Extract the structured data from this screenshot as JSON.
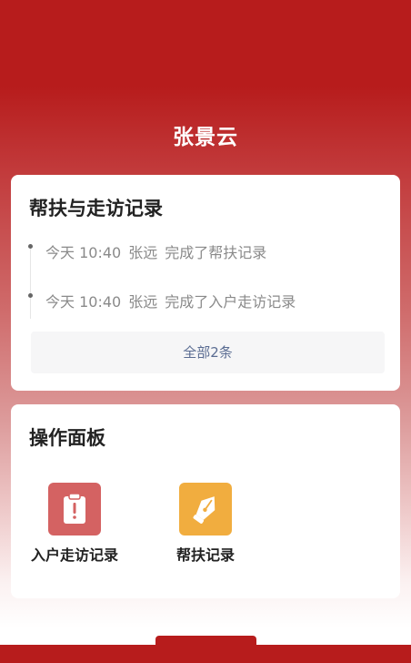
{
  "header": {
    "title": "张景云"
  },
  "records": {
    "title": "帮扶与走访记录",
    "items": [
      {
        "time": "今天 10:40",
        "person": "张远",
        "action": "完成了帮扶记录"
      },
      {
        "time": "今天 10:40",
        "person": "张远",
        "action": "完成了入户走访记录"
      }
    ],
    "all_label": "全部2条"
  },
  "panel": {
    "title": "操作面板",
    "items": [
      {
        "label": "入户走访记录",
        "icon": "clipboard-alert-icon",
        "color": "#d46262"
      },
      {
        "label": "帮扶记录",
        "icon": "pen-nib-icon",
        "color": "#f1ad3f"
      }
    ]
  },
  "colors": {
    "brand": "#b71c1c",
    "link": "#5a6c92"
  }
}
